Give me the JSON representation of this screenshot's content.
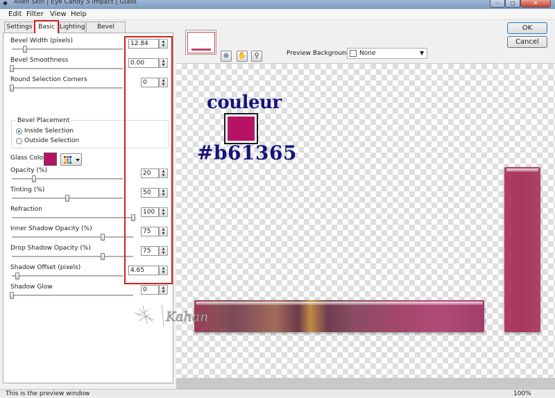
{
  "window": {
    "title": "Alien Skin | Eye Candy 5 Impact | Glass",
    "controls": {
      "minimize": "–",
      "maximize": "□",
      "close": "✕"
    }
  },
  "menu": [
    "Edit",
    "Filter",
    "View",
    "Help"
  ],
  "tabs": [
    "Settings",
    "Basic",
    "Lighting",
    "Bevel Profile"
  ],
  "active_tab": "Basic",
  "controls": {
    "bevel_width": {
      "label": "Bevel Width (pixels)",
      "value": "12.84",
      "slider": 0.12
    },
    "bevel_smoothness": {
      "label": "Bevel Smoothness",
      "value": "0.00",
      "slider": 0.0
    },
    "round_corners": {
      "label": "Round Selection Corners",
      "value": "0",
      "slider": 0.0
    },
    "bevel_placement": {
      "label": "Bevel Placement",
      "options": [
        "Inside Selection",
        "Outside Selection"
      ],
      "selected": "Inside Selection"
    },
    "glass_color": {
      "label": "Glass Color",
      "color": "#b61365"
    },
    "opacity": {
      "label": "Opacity (%)",
      "value": "20",
      "slider": 0.2
    },
    "tinting": {
      "label": "Tinting (%)",
      "value": "50",
      "slider": 0.5
    },
    "refraction": {
      "label": "Refraction",
      "value": "100",
      "slider": 1.0
    },
    "inner_shadow_opacity": {
      "label": "Inner Shadow Opacity (%)",
      "value": "75",
      "slider": 0.75
    },
    "drop_shadow_opacity": {
      "label": "Drop Shadow Opacity (%)",
      "value": "75",
      "slider": 0.75
    },
    "shadow_offset": {
      "label": "Shadow Offset (pixels)",
      "value": "4.65",
      "slider": 0.05
    },
    "shadow_glow": {
      "label": "Shadow Glow",
      "value": "0",
      "slider": 0.0
    }
  },
  "preview_toolbar": {
    "preview_background_label": "Preview Background:",
    "preview_background_value": "None",
    "tools": [
      "zoom-to-fit-icon",
      "hand-icon",
      "magnifier-icon"
    ]
  },
  "buttons": {
    "ok": "OK",
    "cancel": "Cancel"
  },
  "annotation": {
    "word": "couleur",
    "hex": "#b61365",
    "color": "#b61365"
  },
  "signature_text": "Kahan",
  "status": {
    "text": "This is the preview window",
    "zoom": "100%"
  },
  "accent_colors": {
    "highlight_red": "#d61e1e",
    "annotation_blue": "#16137c"
  }
}
